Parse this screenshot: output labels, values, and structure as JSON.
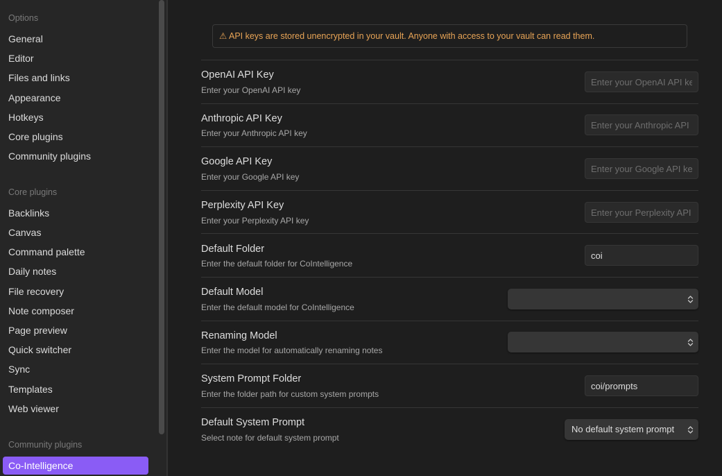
{
  "sidebar": {
    "options_header": "Options",
    "options_items": [
      "General",
      "Editor",
      "Files and links",
      "Appearance",
      "Hotkeys",
      "Core plugins",
      "Community plugins"
    ],
    "core_header": "Core plugins",
    "core_items": [
      "Backlinks",
      "Canvas",
      "Command palette",
      "Daily notes",
      "File recovery",
      "Note composer",
      "Page preview",
      "Quick switcher",
      "Sync",
      "Templates",
      "Web viewer"
    ],
    "community_header": "Community plugins",
    "community_items": [
      "Co-Intelligence"
    ]
  },
  "warning": "⚠ API keys are stored unencrypted in your vault. Anyone with access to your vault can read them.",
  "settings": {
    "openai": {
      "title": "OpenAI API Key",
      "desc": "Enter your OpenAI API key",
      "placeholder": "Enter your OpenAI API key",
      "value": ""
    },
    "anthropic": {
      "title": "Anthropic API Key",
      "desc": "Enter your Anthropic API key",
      "placeholder": "Enter your Anthropic API key",
      "value": ""
    },
    "google": {
      "title": "Google API Key",
      "desc": "Enter your Google API key",
      "placeholder": "Enter your Google API key",
      "value": ""
    },
    "perplexity": {
      "title": "Perplexity API Key",
      "desc": "Enter your Perplexity API key",
      "placeholder": "Enter your Perplexity API key",
      "value": ""
    },
    "default_folder": {
      "title": "Default Folder",
      "desc": "Enter the default folder for CoIntelligence",
      "value": "coi"
    },
    "default_model": {
      "title": "Default Model",
      "desc": "Enter the default model for CoIntelligence",
      "selected": ""
    },
    "renaming_model": {
      "title": "Renaming Model",
      "desc": "Enter the model for automatically renaming notes",
      "selected": ""
    },
    "prompt_folder": {
      "title": "System Prompt Folder",
      "desc": "Enter the folder path for custom system prompts",
      "value": "coi/prompts"
    },
    "default_prompt": {
      "title": "Default System Prompt",
      "desc": "Select note for default system prompt",
      "selected": "No default system prompt"
    }
  },
  "icons": {
    "warning": "warning-icon",
    "chevron": "chevron-updown-icon"
  },
  "colors": {
    "accent": "#8a5cf5",
    "warning": "#e8a456"
  }
}
